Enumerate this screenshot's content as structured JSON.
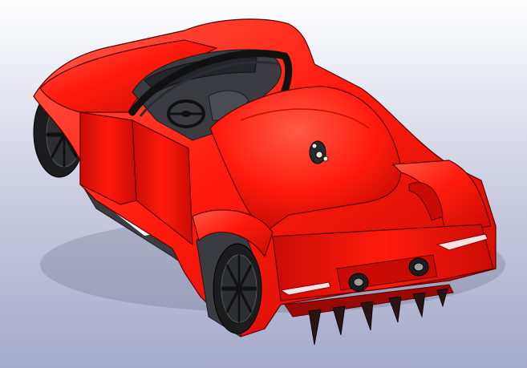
{
  "viewport": {
    "background": {
      "top": "#ffffff",
      "mid": "#c8cbe0",
      "bottom": "#a6aacb"
    }
  },
  "car": {
    "body_color": "#ff1a0d",
    "body_shadow": "#c80c05",
    "body_highlight": "#ff5a46",
    "outline_color": "#5a0000",
    "tire_color": "#1c1c1e",
    "rim_color": "#2c2d30",
    "interior_color": "#3a3c42",
    "diffuser_color": "#9a0a04",
    "livery_colors": [
      "#2f6fe0",
      "#ffffff"
    ],
    "icons": [
      "sports-car-model",
      "roll-bar",
      "steering-wheel",
      "front-left-wheel",
      "rear-left-wheel",
      "rear-diffuser",
      "exhaust-pipe",
      "fuel-cap",
      "tail-light"
    ]
  }
}
